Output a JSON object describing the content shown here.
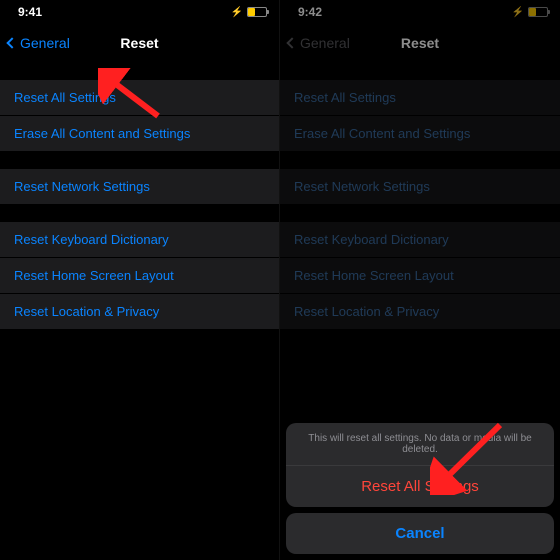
{
  "left": {
    "time": "9:41",
    "back": "General",
    "title": "Reset",
    "rows": [
      "Reset All Settings",
      "Erase All Content and Settings",
      "Reset Network Settings",
      "Reset Keyboard Dictionary",
      "Reset Home Screen Layout",
      "Reset Location & Privacy"
    ]
  },
  "right": {
    "time": "9:42",
    "back": "General",
    "title": "Reset",
    "rows": [
      "Reset All Settings",
      "Erase All Content and Settings",
      "Reset Network Settings",
      "Reset Keyboard Dictionary",
      "Reset Home Screen Layout",
      "Reset Location & Privacy"
    ],
    "sheet": {
      "message": "This will reset all settings. No data or media will be deleted.",
      "action": "Reset All Settings",
      "cancel": "Cancel"
    }
  }
}
